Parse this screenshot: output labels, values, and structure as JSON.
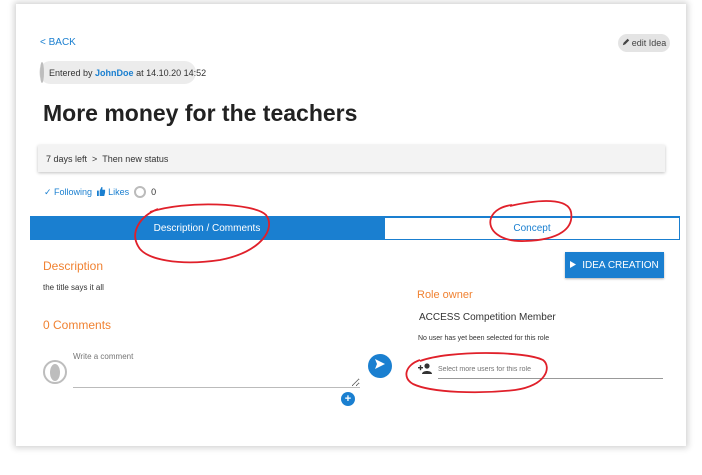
{
  "nav": {
    "back_label": "< BACK"
  },
  "header": {
    "edit_label": "edit Idea",
    "entered_prefix": "Entered by",
    "entered_user": "JohnDoe",
    "entered_suffix": "at 14.10.20 14:52",
    "title": "More money for the teachers"
  },
  "status": {
    "days_left": "7 days left",
    "arrow": ">",
    "next": "Then new status"
  },
  "social": {
    "following": "✓ Following",
    "likes": "Likes",
    "count": "0"
  },
  "tabs": [
    {
      "label": "Description / Comments",
      "active": true
    },
    {
      "label": "Concept",
      "active": false
    }
  ],
  "idea_button": {
    "label": "IDEA CREATION"
  },
  "description": {
    "heading": "Description",
    "text": "the title says it all"
  },
  "comments": {
    "heading": "0 Comments",
    "placeholder": "Write a comment",
    "add_label": "+"
  },
  "role": {
    "heading": "Role owner",
    "name": "ACCESS Competition Member",
    "note": "No user has yet been selected for this role",
    "placeholder": "Select more users for this role"
  },
  "colors": {
    "accent": "#1a7fd0",
    "orange": "#f08232",
    "annotation": "#e0202a"
  },
  "icons": {
    "edit": "pencil-icon",
    "like": "thumbs-up-icon",
    "send": "send-icon",
    "add_user": "add-user-icon",
    "play": "play-icon"
  }
}
